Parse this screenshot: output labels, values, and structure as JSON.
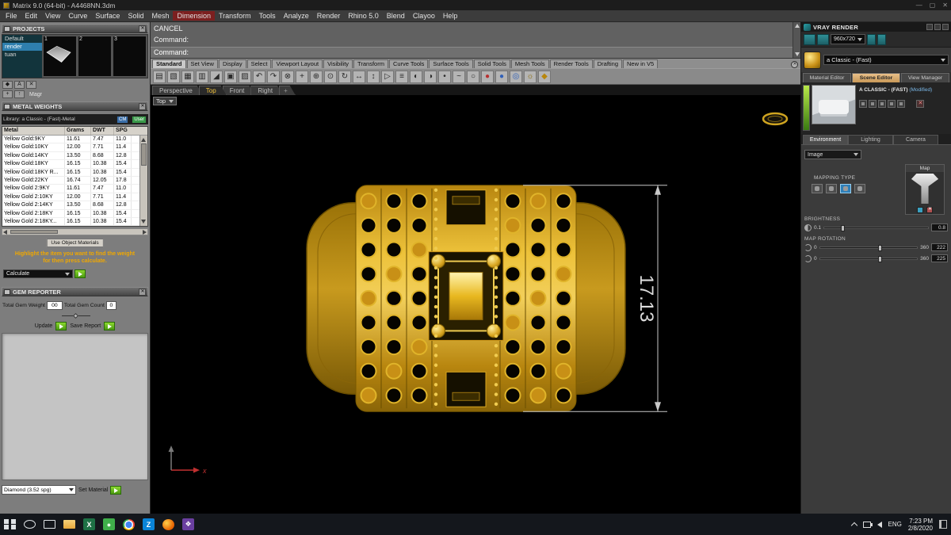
{
  "window": {
    "title": "Matrix 9.0 (64-bit) - A4468NN.3dm",
    "minimize": "—",
    "maximize": "▢",
    "close": "✕"
  },
  "menu": {
    "items": [
      "File",
      "Edit",
      "View",
      "Curve",
      "Surface",
      "Solid",
      "Mesh",
      "Dimension",
      "Transform",
      "Tools",
      "Analyze",
      "Render",
      "Rhino 5.0",
      "Blend",
      "Clayoo",
      "Help"
    ],
    "highlighted": "Dimension"
  },
  "projects": {
    "title": "PROJECTS",
    "items": [
      "Default",
      "render",
      "tuan"
    ],
    "selected": "render",
    "slots": [
      "1",
      "2",
      "3"
    ],
    "buttons_row1": [
      "◆",
      "A",
      "✕"
    ],
    "buttons_row2": [
      "+",
      "↑"
    ],
    "magr_label": "Magr"
  },
  "command": {
    "history_line1": "CANCEL",
    "history_line2": "Command:",
    "prompt_label": "Command:"
  },
  "toolbar": {
    "tabs": [
      "Standard",
      "Set View",
      "Display",
      "Select",
      "Viewport Layout",
      "Visibility",
      "Transform",
      "Curve Tools",
      "Surface Tools",
      "Solid Tools",
      "Mesh Tools",
      "Render Tools",
      "Drafting",
      "New in V5"
    ],
    "active_tab": "Standard",
    "icons": [
      {
        "name": "new-file-icon",
        "glyph": "▤",
        "color": "#2a2a2a"
      },
      {
        "name": "open-file-icon",
        "glyph": "▧",
        "color": "#2a2a2a"
      },
      {
        "name": "save-icon",
        "glyph": "▦",
        "color": "#2a2a2a"
      },
      {
        "name": "print-icon",
        "glyph": "▥",
        "color": "#2a2a2a"
      },
      {
        "name": "cut-icon",
        "glyph": "◢",
        "color": "#2a2a2a"
      },
      {
        "name": "copy-icon",
        "glyph": "▣",
        "color": "#2a2a2a"
      },
      {
        "name": "paste-icon",
        "glyph": "▨",
        "color": "#2a2a2a"
      },
      {
        "name": "undo-icon",
        "glyph": "↶",
        "color": "#2a2a2a"
      },
      {
        "name": "redo-icon",
        "glyph": "↷",
        "color": "#2a2a2a"
      },
      {
        "name": "delete-icon",
        "glyph": "⊗",
        "color": "#2a2a2a"
      },
      {
        "name": "move-icon",
        "glyph": "+",
        "color": "#2a2a2a"
      },
      {
        "name": "zoom-in-icon",
        "glyph": "⊕",
        "color": "#2a2a2a"
      },
      {
        "name": "zoom-extents-icon",
        "glyph": "⊙",
        "color": "#2a2a2a"
      },
      {
        "name": "rotate-view-icon",
        "glyph": "↻",
        "color": "#2a2a2a"
      },
      {
        "name": "pan-icon",
        "glyph": "↔",
        "color": "#2a2a2a"
      },
      {
        "name": "scale-icon",
        "glyph": "↕",
        "color": "#2a2a2a"
      },
      {
        "name": "select-icon",
        "glyph": "▷",
        "color": "#2a2a2a"
      },
      {
        "name": "layers-icon",
        "glyph": "≡",
        "color": "#2a2a2a"
      },
      {
        "name": "hide-icon",
        "glyph": "◐",
        "color": "#2a2a2a"
      },
      {
        "name": "show-icon",
        "glyph": "◑",
        "color": "#2a2a2a"
      },
      {
        "name": "point-icon",
        "glyph": "•",
        "color": "#2a2a2a"
      },
      {
        "name": "curve-icon",
        "glyph": "~",
        "color": "#2a2a2a"
      },
      {
        "name": "circle-icon",
        "glyph": "○",
        "color": "#2a2a2a"
      },
      {
        "name": "render-red-sphere-icon",
        "glyph": "●",
        "color": "#b83030"
      },
      {
        "name": "render-blue-sphere-icon",
        "glyph": "●",
        "color": "#3060b8"
      },
      {
        "name": "globe-icon",
        "glyph": "◎",
        "color": "#3060b8"
      },
      {
        "name": "sun-icon",
        "glyph": "☼",
        "color": "#886600"
      },
      {
        "name": "material-icon",
        "glyph": "◆",
        "color": "#b8860b"
      }
    ]
  },
  "viewport": {
    "tabs": [
      "Perspective",
      "Top",
      "Front",
      "Right"
    ],
    "active_tab": "Top",
    "new_tab_glyph": "+",
    "view_menu_label": "Top",
    "dimension_value": "17.13",
    "axis_x_label": "x"
  },
  "metal_weights": {
    "title": "METAL WEIGHTS",
    "library_label": "Library: a Classic - (Fast)-Metal",
    "toggle_cm": "CM",
    "toggle_user": "User",
    "headers": [
      "Metal",
      "Grams",
      "DWT",
      "SPG"
    ],
    "rows": [
      {
        "metal": "Yellow Gold:9KY",
        "grams": "11.61",
        "dwt": "7.47",
        "spg": "11.0"
      },
      {
        "metal": "Yellow Gold:10KY",
        "grams": "12.00",
        "dwt": "7.71",
        "spg": "11.4"
      },
      {
        "metal": "Yellow Gold:14KY",
        "grams": "13.50",
        "dwt": "8.68",
        "spg": "12.8"
      },
      {
        "metal": "Yellow Gold:18KY",
        "grams": "16.15",
        "dwt": "10.38",
        "spg": "15.4"
      },
      {
        "metal": "Yellow Gold:18KY R...",
        "grams": "16.15",
        "dwt": "10.38",
        "spg": "15.4"
      },
      {
        "metal": "Yellow Gold:22KY",
        "grams": "16.74",
        "dwt": "12.05",
        "spg": "17.8"
      },
      {
        "metal": "Yellow Gold 2:9KY",
        "grams": "11.61",
        "dwt": "7.47",
        "spg": "11.0"
      },
      {
        "metal": "Yellow Gold 2:10KY",
        "grams": "12.00",
        "dwt": "7.71",
        "spg": "11.4"
      },
      {
        "metal": "Yellow Gold 2:14KY",
        "grams": "13.50",
        "dwt": "8.68",
        "spg": "12.8"
      },
      {
        "metal": "Yellow Gold 2:18KY",
        "grams": "16.15",
        "dwt": "10.38",
        "spg": "15.4"
      },
      {
        "metal": "Yellow Gold 2:18KY...",
        "grams": "16.15",
        "dwt": "10.38",
        "spg": "15.4"
      }
    ],
    "use_object_materials_label": "Use Object Materials",
    "hint_line1": "Highlight the item you want to find the weight",
    "hint_line2": "for then press calculate.",
    "calculate_label": "Calculate"
  },
  "gem_reporter": {
    "title": "GEM REPORTER",
    "weight_label": "Total Gem Weight",
    "weight_value": "00",
    "count_label": "Total Gem Count",
    "count_value": "0",
    "update_label": "Update",
    "save_label": "Save Report",
    "material_dropdown": "Diamond    (3.52 spg)",
    "set_material_label": "Set Material"
  },
  "vray": {
    "title": "VRAY RENDER",
    "resolution": "960x720",
    "material_dropdown": "a Classic - (Fast)",
    "tabs": [
      "Material Editor",
      "Scene Editor",
      "View Manager"
    ],
    "active_tab": "Scene Editor",
    "preview_label": "A CLASSIC - (FAST)",
    "preview_modified": "(Modified)",
    "preview_buttons": [
      "material-list-icon",
      "grid-view-icon",
      "save-material-icon",
      "edit-material-icon",
      "refresh-preview-icon",
      "close-preview-icon"
    ],
    "sub_tabs": [
      "Environment",
      "Lighting",
      "Camera"
    ],
    "active_sub_tab": "Environment",
    "image_dropdown": "Image",
    "mapping_type_label": "MAPPING TYPE",
    "mapping_icons": [
      "uvw-map-icon",
      "spherical-map-icon",
      "cylindrical-map-icon",
      "planar-map-icon"
    ],
    "mapping_active_index": 2,
    "map_label": "Map",
    "brightness_label": "BRIGHTNESS",
    "brightness_min": "0.1",
    "brightness_value": "0.8",
    "map_rotation_label": "MAP ROTATION",
    "rotation_min": "0",
    "rotation_max": "360",
    "rotation1_value": "222",
    "rotation2_value": "225"
  },
  "taskbar": {
    "icons": [
      {
        "name": "start-button",
        "cls": "winlogo"
      },
      {
        "name": "search-button",
        "cls": "searchc"
      },
      {
        "name": "task-view-button",
        "cls": "taskview"
      },
      {
        "name": "file-explorer-icon",
        "cls": "folder"
      },
      {
        "name": "excel-icon",
        "glyph": "X",
        "bg": "#1e7145",
        "color": "#ffffff"
      },
      {
        "name": "messenger-icon",
        "glyph": "●",
        "bg": "#3fae4a",
        "color": "#eaffea"
      },
      {
        "name": "chrome-icon",
        "cls": "chrome"
      },
      {
        "name": "zalo-icon",
        "glyph": "Z",
        "bg": "#0a84d8",
        "color": "#ffffff"
      },
      {
        "name": "firefox-icon",
        "cls": "ffx"
      },
      {
        "name": "matrix-app-icon",
        "glyph": "❖",
        "bg": "#6a3fa0",
        "color": "#ffffff"
      }
    ],
    "language": "ENG",
    "time": "7:23 PM",
    "date": "2/8/2020"
  }
}
